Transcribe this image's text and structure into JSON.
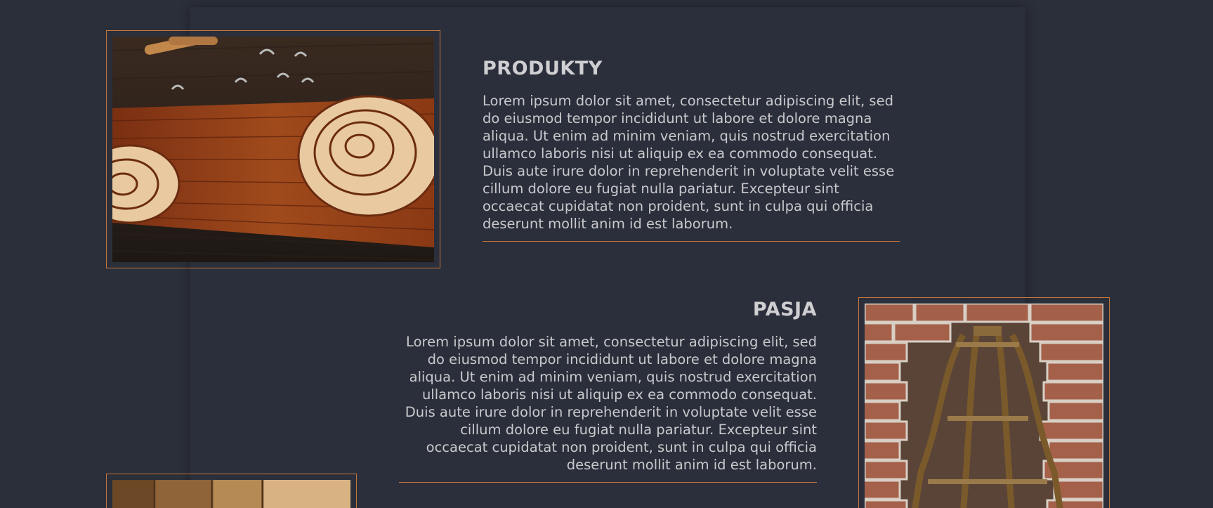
{
  "sections": [
    {
      "title": "PRODUKTY",
      "text": "Lorem ipsum dolor sit amet, consectetur adipiscing elit, sed do eiusmod tempor incididunt ut labore et dolore magna aliqua. Ut enim ad minim veniam, quis nostrud exercitation ullamco laboris nisi ut aliquip ex ea commodo consequat. Duis aute irure dolor in reprehenderit in voluptate velit esse cillum dolore eu fugiat nulla pariatur. Excepteur sint occaecat cupidatat non proident, sunt in culpa qui officia deserunt mollit anim id est laborum."
    },
    {
      "title": "PASJA",
      "text": "Lorem ipsum dolor sit amet, consectetur adipiscing elit, sed do eiusmod tempor incididunt ut labore et dolore magna aliqua. Ut enim ad minim veniam, quis nostrud exercitation ullamco laboris nisi ut aliquip ex ea commodo consequat. Duis aute irure dolor in reprehenderit in voluptate velit esse cillum dolore eu fugiat nulla pariatur. Excepteur sint occaecat cupidatat non proident, sunt in culpa qui officia deserunt mollit anim id est laborum."
    }
  ],
  "colors": {
    "background": "#2b2f3a",
    "accent": "#c8763a",
    "text": "#c9c9cc"
  }
}
